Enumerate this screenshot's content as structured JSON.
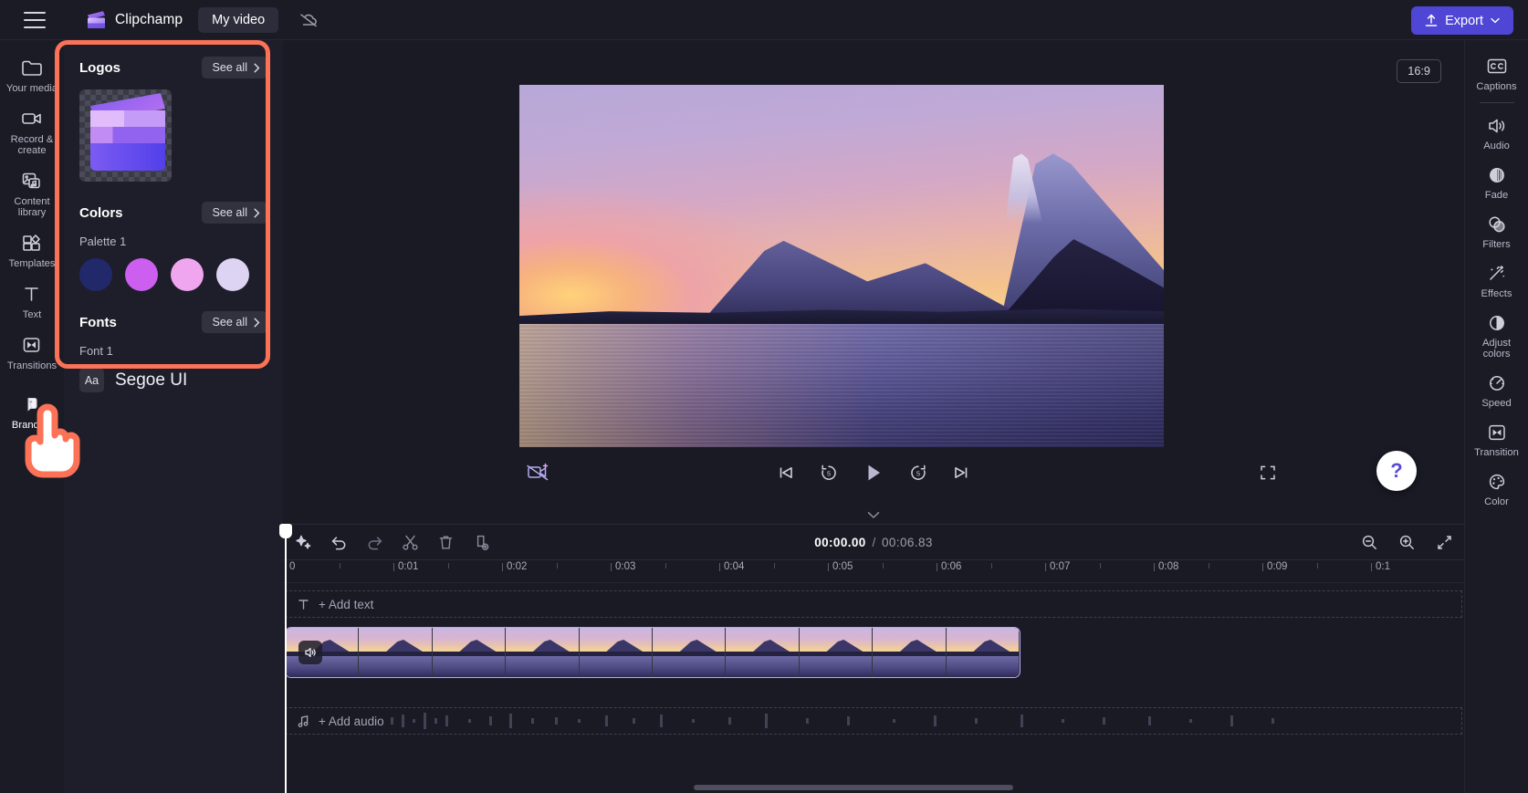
{
  "app": {
    "name": "Clipchamp",
    "project_tab": "My video",
    "menu_icon": "hamburger-icon",
    "cloud_icon": "cloud-off-icon",
    "export_label": "Export",
    "export_color": "#4f46d6"
  },
  "left_rail": {
    "items": [
      {
        "label": "Your media",
        "icon": "folder-icon",
        "active": false
      },
      {
        "label": "Record & create",
        "icon": "video-camera-icon",
        "active": false
      },
      {
        "label": "Content library",
        "icon": "content-library-icon",
        "active": false
      },
      {
        "label": "Templates",
        "icon": "templates-icon",
        "active": false
      },
      {
        "label": "Text",
        "icon": "text-icon",
        "active": false
      },
      {
        "label": "Transitions",
        "icon": "transitions-icon",
        "active": false
      }
    ],
    "bottom_item": {
      "label": "Brand kit",
      "icon": "brand-kit-icon",
      "active": true
    }
  },
  "panel": {
    "highlight_color": "#fc7257",
    "logos": {
      "title": "Logos",
      "see_all": "See all",
      "thumb_name": "clapperboard-logo"
    },
    "colors": {
      "title": "Colors",
      "see_all": "See all",
      "palette_label": "Palette 1",
      "swatches": [
        "#21296b",
        "#cc5ef0",
        "#efa6ef",
        "#ddd3f2"
      ]
    },
    "fonts": {
      "title": "Fonts",
      "see_all": "See all",
      "font_label": "Font 1",
      "sample_glyph": "Aa",
      "font_name": "Segoe UI"
    }
  },
  "stage": {
    "aspect_ratio": "16:9",
    "collapse_left_icon": "chevron-left-icon",
    "collapse_right_icon": "chevron-left-icon",
    "caret_icon": "chevron-down-icon",
    "help_label": "?",
    "transport": {
      "auto_compose_icon": "magic-video-icon",
      "skip_start_icon": "skip-to-start-icon",
      "back5_icon": "rewind-5-icon",
      "back5_label": "5",
      "play_icon": "play-icon",
      "fwd5_icon": "forward-5-icon",
      "fwd5_label": "5",
      "skip_end_icon": "skip-to-end-icon",
      "fullscreen_icon": "fullscreen-icon"
    }
  },
  "right_rail": {
    "items": [
      {
        "label": "Captions",
        "icon": "closed-captions-icon"
      },
      {
        "label": "Audio",
        "icon": "speaker-icon"
      },
      {
        "label": "Fade",
        "icon": "fade-icon"
      },
      {
        "label": "Filters",
        "icon": "filters-icon"
      },
      {
        "label": "Effects",
        "icon": "magic-wand-icon"
      },
      {
        "label": "Adjust colors",
        "icon": "contrast-icon"
      },
      {
        "label": "Speed",
        "icon": "speedometer-icon"
      },
      {
        "label": "Transition",
        "icon": "transition-icon"
      },
      {
        "label": "Color",
        "icon": "palette-icon"
      }
    ]
  },
  "timeline": {
    "tools": [
      {
        "name": "auto-compose-icon"
      },
      {
        "name": "undo-icon"
      },
      {
        "name": "redo-icon"
      },
      {
        "name": "split-icon"
      },
      {
        "name": "delete-icon"
      },
      {
        "name": "duplicate-icon"
      }
    ],
    "current_time": "00:00.00",
    "separator": "/",
    "total_time": "00:06.83",
    "zoom_out_icon": "zoom-out-icon",
    "zoom_in_icon": "zoom-in-icon",
    "fit_icon": "fit-to-screen-icon",
    "ruler_labels": [
      "0",
      "0:01",
      "0:02",
      "0:03",
      "0:04",
      "0:05",
      "0:06",
      "0:07",
      "0:08",
      "0:09",
      "0:1"
    ],
    "text_track": {
      "label": "+ Add text",
      "icon": "text-icon"
    },
    "audio_track": {
      "label": "+ Add audio",
      "icon": "music-note-icon"
    },
    "clip": {
      "mute_icon": "speaker-icon",
      "frame_count": 10
    }
  },
  "cursor": {
    "icon": "pointing-hand-cursor"
  }
}
